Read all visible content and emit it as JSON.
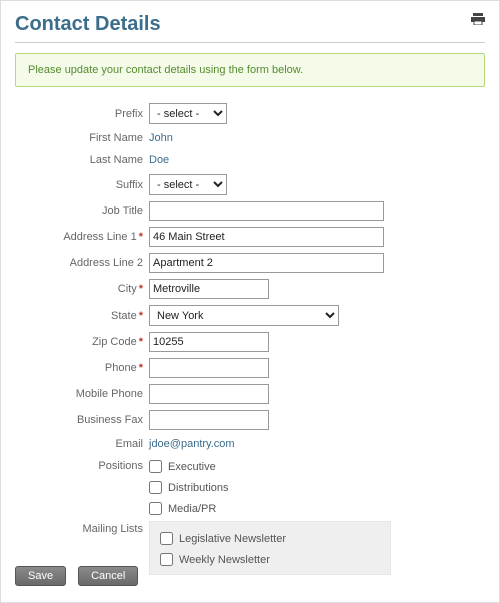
{
  "title": "Contact Details",
  "notice": "Please update your contact details using the form below.",
  "select_placeholder": "- select -",
  "labels": {
    "prefix": "Prefix",
    "first_name": "First Name",
    "last_name": "Last Name",
    "suffix": "Suffix",
    "job_title": "Job Title",
    "address1": "Address Line 1",
    "address2": "Address Line 2",
    "city": "City",
    "state": "State",
    "zip": "Zip Code",
    "phone": "Phone",
    "mobile": "Mobile Phone",
    "fax": "Business Fax",
    "email": "Email",
    "positions": "Positions",
    "mailing": "Mailing Lists"
  },
  "values": {
    "first_name": "John",
    "last_name": "Doe",
    "job_title": "",
    "address1": "46 Main Street",
    "address2": "Apartment 2",
    "city": "Metroville",
    "state": "New York",
    "zip": "10255",
    "phone": "",
    "mobile": "",
    "fax": "",
    "email": "jdoe@pantry.com"
  },
  "positions": [
    "Executive",
    "Distributions",
    "Media/PR"
  ],
  "mailing_lists": [
    "Legislative Newsletter",
    "Weekly Newsletter"
  ],
  "required": {
    "address1": true,
    "city": true,
    "state": true,
    "zip": true,
    "phone": true
  },
  "buttons": {
    "save": "Save",
    "cancel": "Cancel"
  },
  "req_mark": "*"
}
